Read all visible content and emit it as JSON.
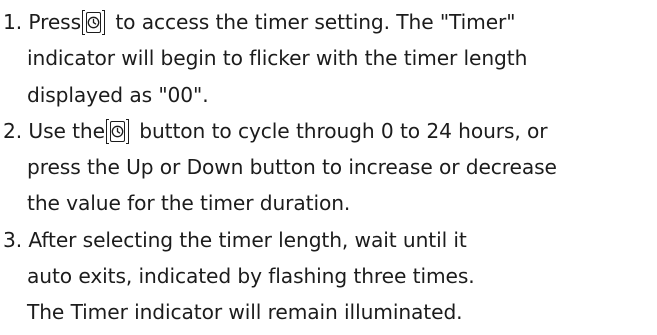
{
  "steps": [
    {
      "number": "1.",
      "lines": [
        {
          "before": "Press",
          "after": " to access the timer setting. The \"Timer\""
        },
        {
          "text": "indicator will begin to flicker with the timer length"
        },
        {
          "text": "displayed as \"00\"."
        }
      ]
    },
    {
      "number": "2.",
      "lines": [
        {
          "before": "Use the",
          "after": " button to cycle through 0 to 24 hours, or"
        },
        {
          "text": "press the Up or Down button to increase or decrease"
        },
        {
          "text": "the value for the timer duration."
        }
      ]
    },
    {
      "number": "3.",
      "lines": [
        {
          "text": "After selecting the timer length, wait until it"
        },
        {
          "text": "auto exits, indicated by flashing three times."
        },
        {
          "text": "The Timer indicator will remain illuminated."
        }
      ]
    }
  ],
  "icons": {
    "timer_button": "clock-icon"
  }
}
